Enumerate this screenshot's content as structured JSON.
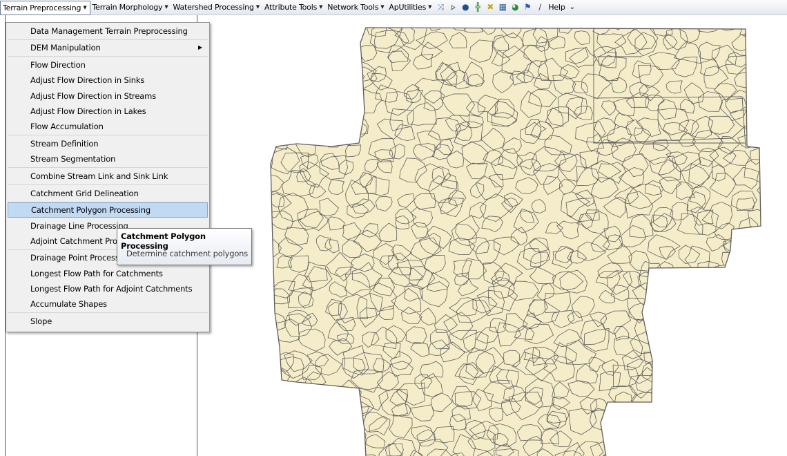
{
  "toolbar": {
    "menus": [
      {
        "label": "Terrain Preprocessing"
      },
      {
        "label": "Terrain Morphology"
      },
      {
        "label": "Watershed Processing"
      },
      {
        "label": "Attribute Tools"
      },
      {
        "label": "Network Tools"
      },
      {
        "label": "ApUtilities"
      }
    ],
    "icons": [
      "flow-path-icon",
      "edit-line-icon",
      "point-delineation-icon",
      "split-icon",
      "batch-point-icon",
      "network-icon",
      "globe-icon",
      "flag-icon",
      "pencil-icon"
    ],
    "help_label": "Help",
    "overflow_glyph": "⌄"
  },
  "menu": {
    "items": [
      "Data Management Terrain Preprocessing",
      "DEM Manipulation",
      "Flow Direction",
      "Adjust Flow Direction in Sinks",
      "Adjust Flow Direction in Streams",
      "Adjust Flow Direction in Lakes",
      "Flow Accumulation",
      "Stream Definition",
      "Stream Segmentation",
      "Combine Stream Link and Sink Link",
      "Catchment Grid Delineation",
      "Catchment Polygon Processing",
      "Drainage Line Processing",
      "Adjoint Catchment Processing",
      "Drainage Point Processing",
      "Longest Flow Path for Catchments",
      "Longest Flow Path for Adjoint Catchments",
      "Accumulate Shapes",
      "Slope"
    ],
    "highlighted_index": 11,
    "submenu_index": 1
  },
  "tooltip": {
    "title": "Catchment Polygon Processing",
    "description": "Determine catchment polygons"
  },
  "colors": {
    "catchment_fill": "#f5edc9",
    "catchment_outline": "#5d5d5d",
    "highlight": "#c2d9f2"
  }
}
